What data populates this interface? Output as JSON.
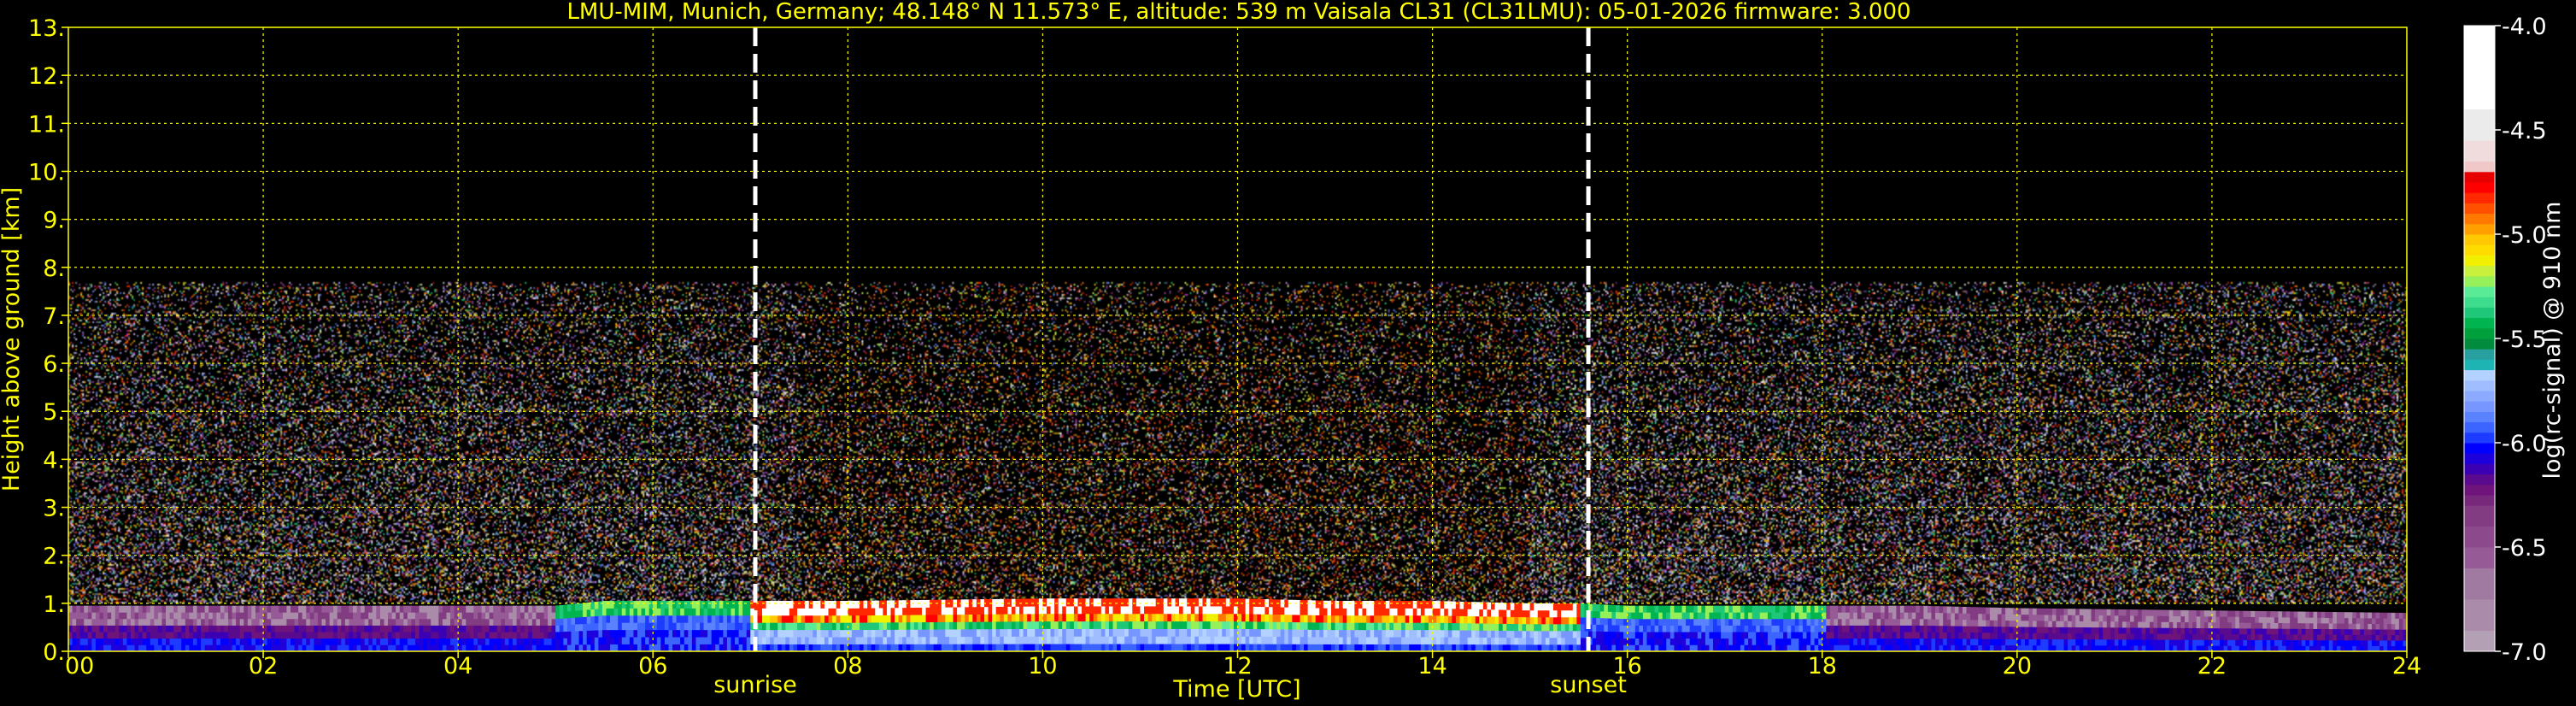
{
  "title": "LMU-MIM, Munich, Germany; 48.148° N 11.573° E, altitude: 539 m    Vaisala CL31 (CL31LMU): 05-01-2026    firmware: 3.000",
  "colors": {
    "background": "#000000",
    "axis_text": "#ffff00",
    "grid": "#ffff00",
    "cbar_text": "#ffffff",
    "sun_lines": "#ffffff"
  },
  "chart_data": {
    "type": "heatmap",
    "xlabel": "Time [UTC]",
    "ylabel": "Height above ground [km]",
    "xlim": [
      0,
      24
    ],
    "ylim": [
      0,
      13
    ],
    "x_ticks": [
      "00",
      "02",
      "04",
      "06",
      "08",
      "10",
      "12",
      "14",
      "16",
      "18",
      "20",
      "22",
      "24"
    ],
    "x_tick_values": [
      0,
      2,
      4,
      6,
      8,
      10,
      12,
      14,
      16,
      18,
      20,
      22,
      24
    ],
    "y_ticks": [
      "0.",
      "1.",
      "2.",
      "3.",
      "4.",
      "5.",
      "6.",
      "7.",
      "8.",
      "9.",
      "10.",
      "11.",
      "12.",
      "13."
    ],
    "y_tick_values": [
      0,
      1,
      2,
      3,
      4,
      5,
      6,
      7,
      8,
      9,
      10,
      11,
      12,
      13
    ],
    "grid": true,
    "noise_top_km": 7.7,
    "boundary_layer": {
      "hours": [
        0,
        2,
        4,
        5,
        5.5,
        6,
        7,
        8,
        10,
        12,
        13,
        14,
        15,
        15.5,
        16,
        18,
        19,
        20,
        22,
        24
      ],
      "top_km": [
        0.95,
        0.95,
        0.95,
        0.95,
        1.05,
        1.05,
        1.05,
        1.05,
        1.1,
        1.1,
        1.05,
        1.05,
        1.0,
        1.0,
        0.95,
        0.95,
        0.95,
        0.9,
        0.85,
        0.8
      ]
    },
    "annotations": [
      {
        "label": "sunrise",
        "x": 7.05
      },
      {
        "label": "sunset",
        "x": 15.6
      }
    ],
    "colorbar": {
      "label": "log(rc-signal) @ 910 nm",
      "range": [
        -7.0,
        -4.0
      ],
      "ticks": [
        "-4.0",
        "-4.5",
        "-5.0",
        "-5.5",
        "-6.0",
        "-6.5",
        "-7.0"
      ],
      "tick_values": [
        -4.0,
        -4.5,
        -5.0,
        -5.5,
        -6.0,
        -6.5,
        -7.0
      ],
      "levels": [
        -7.0,
        -6.9,
        -6.75,
        -6.6,
        -6.5,
        -6.4,
        -6.3,
        -6.25,
        -6.2,
        -6.15,
        -6.1,
        -6.05,
        -6.0,
        -5.95,
        -5.9,
        -5.85,
        -5.8,
        -5.75,
        -5.7,
        -5.65,
        -5.6,
        -5.55,
        -5.5,
        -5.45,
        -5.4,
        -5.35,
        -5.3,
        -5.25,
        -5.2,
        -5.15,
        -5.1,
        -5.05,
        -5.0,
        -4.95,
        -4.9,
        -4.85,
        -4.8,
        -4.75,
        -4.7,
        -4.65,
        -4.55,
        -4.4,
        -4.0
      ],
      "colors": [
        "#b4a0b4",
        "#aa8caa",
        "#a07aa0",
        "#965a96",
        "#8c4a8c",
        "#823c82",
        "#78287a",
        "#6e147a",
        "#5a0a8c",
        "#3c00b4",
        "#1e00dc",
        "#0000ff",
        "#1e3cff",
        "#3c64ff",
        "#5a82ff",
        "#7896ff",
        "#8caaff",
        "#a0beff",
        "#b4d2ff",
        "#1eb4b4",
        "#28a0a0",
        "#008c3c",
        "#00a03c",
        "#00b450",
        "#1ec878",
        "#3cdc8c",
        "#5aeb96",
        "#96f05a",
        "#c8f03c",
        "#f0f000",
        "#ffdc00",
        "#ffc800",
        "#ffa000",
        "#ff7800",
        "#ff5000",
        "#ff2800",
        "#ff0000",
        "#e60000",
        "#f0c8c8",
        "#f0dcdc",
        "#ebebeb",
        "#ffffff"
      ]
    }
  }
}
